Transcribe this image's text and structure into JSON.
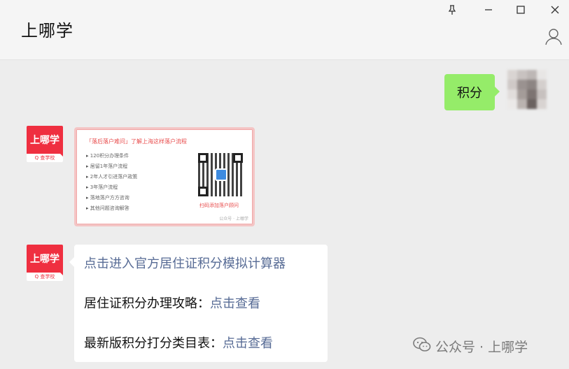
{
  "window": {
    "title": "上哪学",
    "controls": {
      "pin_icon": "pin-icon",
      "minimize_icon": "minimize-icon",
      "maximize_icon": "maximize-icon",
      "close_icon": "close-icon"
    },
    "profile_icon": "person-icon"
  },
  "brand_avatar": {
    "main_text": "上哪学",
    "sub_text": "Q 查学校"
  },
  "messages": [
    {
      "side": "right",
      "type": "text",
      "text": "积分"
    },
    {
      "side": "left",
      "type": "image",
      "card": {
        "headline": "「落后落户难问」了解上海这样落户流程",
        "items": [
          "120积分办理条件",
          "居留1年落户流程",
          "2年人才引进落户政策",
          "3年落户流程",
          "落地落户方方咨询",
          "其他问题咨询解答"
        ],
        "caption": "扫码添加落户顾问",
        "footer": "公众号 · 上哪学"
      }
    },
    {
      "side": "left",
      "type": "links",
      "lines": [
        {
          "prefix": "",
          "link": "点击进入官方居住证积分模拟计算器"
        },
        {
          "prefix": "居住证积分办理攻略：",
          "link": "点击查看"
        },
        {
          "prefix": "最新版积分打分类目表：",
          "link": "点击查看"
        }
      ]
    }
  ],
  "watermark": {
    "icon": "wechat-icon",
    "text": "公众号 · 上哪学"
  },
  "colors": {
    "sent_bubble": "#95ec69",
    "link": "#576b95",
    "brand_red": "#ef2f40"
  }
}
